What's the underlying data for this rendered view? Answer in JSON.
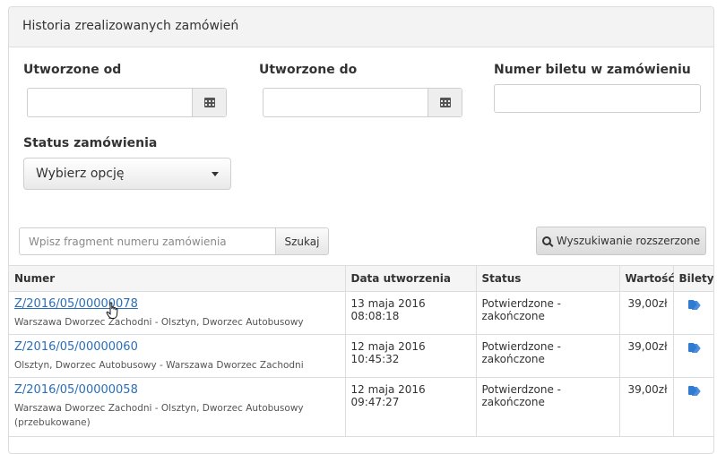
{
  "panel": {
    "title": "Historia zrealizowanych zamówień"
  },
  "filters": {
    "created_from_label": "Utworzone od",
    "created_to_label": "Utworzone do",
    "ticket_number_label": "Numer biletu w zamówieniu",
    "status_label": "Status zamówienia",
    "status_select_value": "Wybierz opcję"
  },
  "search": {
    "placeholder": "Wpisz fragment numeru zamówienia",
    "search_button": "Szukaj",
    "advanced_button": "Wyszukiwanie rozszerzone"
  },
  "table": {
    "headers": [
      "Numer",
      "Data utworzenia",
      "Status",
      "Wartość",
      "Bilety"
    ],
    "rows": [
      {
        "number": "Z/2016/05/00000078",
        "route": "Warszawa Dworzec Zachodni - Olsztyn, Dworzec Autobusowy",
        "date": "13 maja 2016 08:08:18",
        "status": "Potwierdzone - zakończone",
        "value": "39,00zł"
      },
      {
        "number": "Z/2016/05/00000060",
        "route": "Olsztyn, Dworzec Autobusowy - Warszawa Dworzec Zachodni",
        "date": "12 maja 2016 10:45:32",
        "status": "Potwierdzone - zakończone",
        "value": "39,00zł"
      },
      {
        "number": "Z/2016/05/00000058",
        "route": "Warszawa Dworzec Zachodni - Olsztyn, Dworzec Autobusowy (przebukowane)",
        "date": "12 maja 2016 09:47:27",
        "status": "Potwierdzone - zakończone",
        "value": "39,00zł"
      }
    ]
  },
  "colors": {
    "link": "#2a6fb8",
    "tag": "#2f7bd4",
    "header_bg": "#f3f3f3"
  },
  "icons": [
    "calendar-icon",
    "chevron-down-icon",
    "search-icon",
    "tags-icon",
    "hand-cursor-icon"
  ]
}
